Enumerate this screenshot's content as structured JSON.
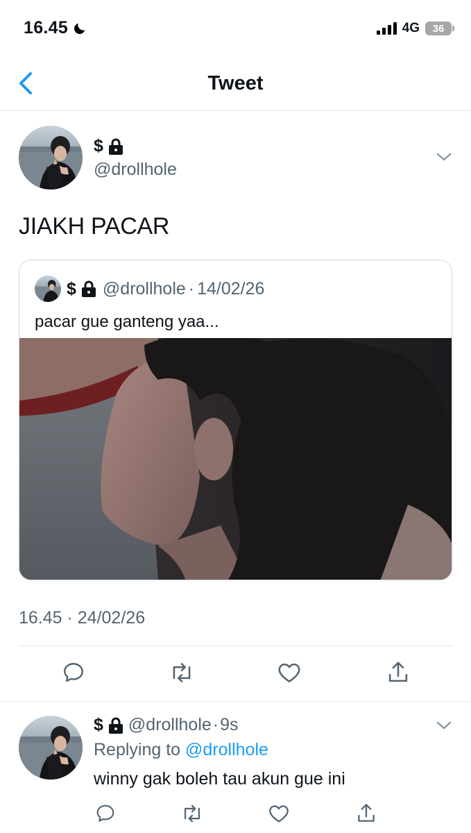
{
  "status_bar": {
    "time": "16.45",
    "network": "4G",
    "battery": "36"
  },
  "nav": {
    "title": "Tweet"
  },
  "tweet": {
    "display_name": "$",
    "handle": "@drollhole",
    "text": "JIAKH PACAR",
    "timestamp": "16.45 · 24/02/26",
    "quoted": {
      "display_name": "$",
      "handle": "@drollhole",
      "separator": "·",
      "date": "14/02/26",
      "text": "pacar gue ganteng yaa..."
    }
  },
  "reply": {
    "display_name": "$",
    "handle": "@drollhole",
    "separator": "·",
    "age": "9s",
    "replying_label": "Replying to",
    "replying_to": "@drollhole",
    "text": "winny gak boleh tau akun gue ini"
  },
  "icons": {
    "back": "chevron-left-icon",
    "more": "chevron-down-icon",
    "reply": "comment-icon",
    "retweet": "retweet-icon",
    "like": "heart-icon",
    "share": "share-icon",
    "lock": "lock-icon",
    "moon": "moon-icon"
  },
  "colors": {
    "accent": "#1d9bf0",
    "secondary_text": "#536471",
    "divider": "#e1e8ed"
  }
}
